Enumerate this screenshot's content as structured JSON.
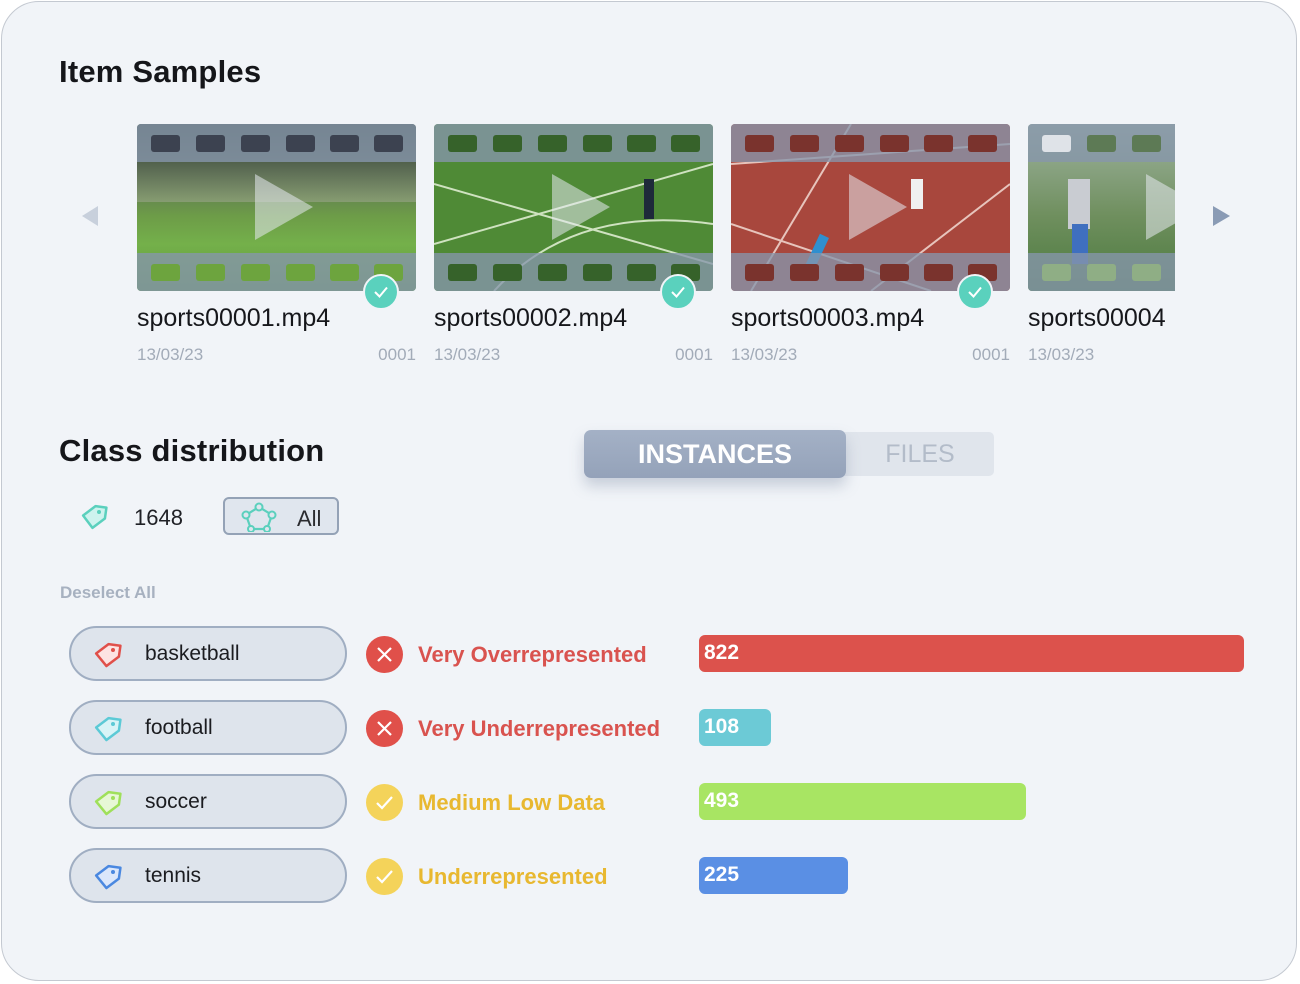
{
  "item_samples": {
    "title": "Item Samples",
    "items": [
      {
        "filename": "sports00001.mp4",
        "date": "13/03/23",
        "number": "0001",
        "checked": true
      },
      {
        "filename": "sports00002.mp4",
        "date": "13/03/23",
        "number": "0001",
        "checked": true
      },
      {
        "filename": "sports00003.mp4",
        "date": "13/03/23",
        "number": "0001",
        "checked": true
      },
      {
        "filename": "sports00004",
        "date": "13/03/23",
        "number": "",
        "checked": false
      }
    ]
  },
  "class_distribution": {
    "title": "Class distribution",
    "toggle": {
      "instances": "INSTANCES",
      "files": "FILES",
      "active": "INSTANCES"
    },
    "total_count": "1648",
    "filter_label": "All",
    "deselect_all": "Deselect All",
    "max_value": 822,
    "classes": [
      {
        "name": "basketball",
        "status": "Very Overrepresented",
        "status_icon": "x-icon",
        "status_color": "#d9534f",
        "tag_color": "#e0504a",
        "bar_color": "#dc524c",
        "value": 822
      },
      {
        "name": "football",
        "status": "Very Underrepresented",
        "status_icon": "x-icon",
        "status_color": "#d9534f",
        "tag_color": "#5ccad6",
        "bar_color": "#6ccad6",
        "value": 108
      },
      {
        "name": "soccer",
        "status": "Medium Low Data",
        "status_icon": "check-icon",
        "status_color": "#e8b830",
        "tag_color": "#9fe05a",
        "bar_color": "#a8e563",
        "value": 493
      },
      {
        "name": "tennis",
        "status": "Underrepresented",
        "status_icon": "check-icon",
        "status_color": "#e8b830",
        "tag_color": "#4a88e0",
        "bar_color": "#5a8fe4",
        "value": 225
      }
    ]
  }
}
